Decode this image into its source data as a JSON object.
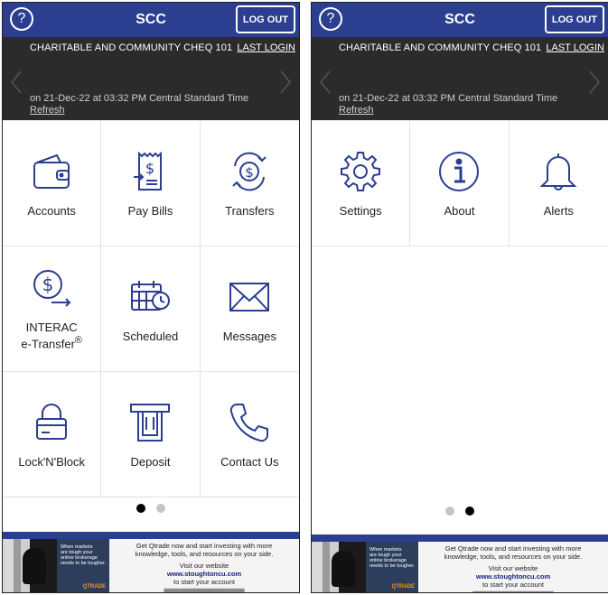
{
  "header": {
    "title": "SCC",
    "help_icon": "?",
    "logout_label": "LOG OUT"
  },
  "banner": {
    "account_name": "CHARITABLE AND COMMUNITY CHEQ 101",
    "last_login_label": "LAST LOGIN",
    "last_login_time": "on 21-Dec-22 at 03:32 PM Central Standard Time",
    "refresh_label": "Refresh"
  },
  "page1": {
    "tiles": [
      {
        "label": "Accounts",
        "icon": "wallet-icon"
      },
      {
        "label": "Pay Bills",
        "icon": "bill-icon"
      },
      {
        "label": "Transfers",
        "icon": "transfer-icon"
      },
      {
        "label": "INTERAC",
        "label_line2": "e-Transfer",
        "sup": "®",
        "icon": "interac-icon"
      },
      {
        "label": "Scheduled",
        "icon": "calendar-clock-icon"
      },
      {
        "label": "Messages",
        "icon": "envelope-icon"
      },
      {
        "label": "Lock'N'Block",
        "icon": "lock-card-icon"
      },
      {
        "label": "Deposit",
        "icon": "atm-icon"
      },
      {
        "label": "Contact Us",
        "icon": "phone-icon"
      }
    ],
    "active_page": 1
  },
  "page2": {
    "tiles": [
      {
        "label": "Settings",
        "icon": "gear-icon"
      },
      {
        "label": "About",
        "icon": "info-icon"
      },
      {
        "label": "Alerts",
        "icon": "bell-icon"
      }
    ],
    "active_page": 2
  },
  "ad": {
    "photo_text_1": "When markets",
    "photo_text_2": "are tough your",
    "photo_text_3": "online brokerage",
    "photo_text_4": "needs to be tougher.",
    "logo": "QTRADE",
    "line1": "Get Qtrade now and start investing with more",
    "line2": "knowledge, tools, and resources on your side.",
    "line3": "Visit our website",
    "url": "www.stoughtoncu.com",
    "line4": "to start your account"
  },
  "colors": {
    "brand": "#2c3e8f",
    "banner_bg": "#2b2b2b",
    "icon": "#2c3e8f"
  }
}
